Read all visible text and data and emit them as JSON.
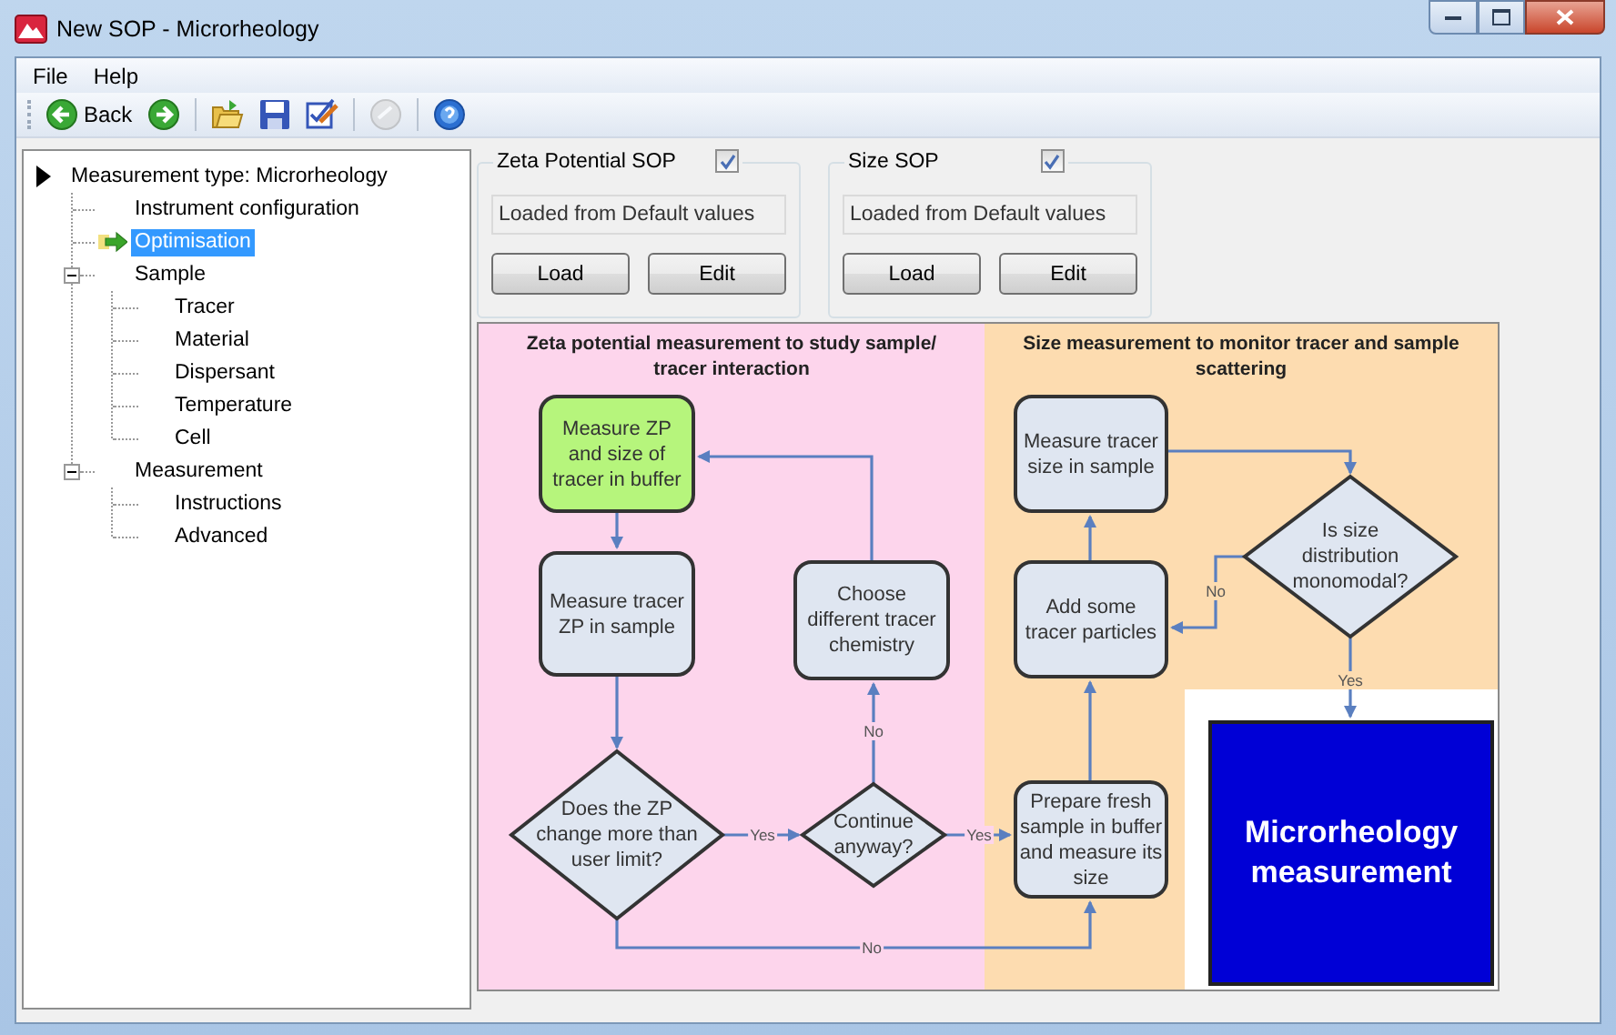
{
  "window": {
    "title": "New SOP - Microrheology"
  },
  "menu": [
    "File",
    "Help"
  ],
  "toolbar": [
    {
      "kind": "back",
      "label": "Back",
      "disabled": false
    },
    {
      "kind": "forward",
      "disabled": false
    },
    {
      "kind": "open",
      "disabled": false
    },
    {
      "kind": "save",
      "disabled": false
    },
    {
      "kind": "edit",
      "disabled": false
    },
    {
      "kind": "cancel",
      "disabled": true
    },
    {
      "kind": "help",
      "disabled": false
    }
  ],
  "tree": {
    "title": "Measurement type: Microrheology",
    "items": [
      {
        "label": "Instrument configuration",
        "selected": false,
        "current": false
      },
      {
        "label": "Optimisation",
        "selected": true,
        "current": true
      },
      {
        "label": "Sample",
        "selected": false,
        "current": false,
        "expanded": true,
        "children": [
          {
            "label": "Tracer",
            "selected": false,
            "current": false
          },
          {
            "label": "Material",
            "selected": false,
            "current": false
          },
          {
            "label": "Dispersant",
            "selected": false,
            "current": false
          },
          {
            "label": "Temperature",
            "selected": false,
            "current": false
          },
          {
            "label": "Cell",
            "selected": false,
            "current": false
          }
        ]
      },
      {
        "label": "Measurement",
        "selected": false,
        "current": false,
        "expanded": true,
        "children": [
          {
            "label": "Instructions",
            "selected": false,
            "current": false
          },
          {
            "label": "Advanced",
            "selected": false,
            "current": false
          }
        ]
      }
    ]
  },
  "sops": [
    {
      "label": "Zeta Potential SOP",
      "checked": true,
      "status": "Loaded from Default values",
      "buttons": [
        "Load",
        "Edit"
      ]
    },
    {
      "label": "Size SOP",
      "checked": true,
      "status": "Loaded from Default values",
      "buttons": [
        "Load",
        "Edit"
      ]
    }
  ],
  "flowchart": {
    "panels": [
      {
        "title": [
          "Zeta potential measurement to study sample/",
          "tracer interaction"
        ],
        "color": "#fdd5ec"
      },
      {
        "title": [
          "Size measurement to monitor tracer and sample",
          "scattering"
        ],
        "color": "#fddcb0"
      }
    ],
    "nodes": [
      {
        "kind": "process",
        "lines": [
          "Measure ZP",
          "and size of",
          "tracer in buffer"
        ],
        "color": "#b6f57c"
      },
      {
        "kind": "process",
        "lines": [
          "Measure tracer",
          "ZP in sample"
        ],
        "color": "#dfe6f1"
      },
      {
        "kind": "process",
        "lines": [
          "Choose",
          "different tracer",
          "chemistry"
        ],
        "color": "#dfe6f1"
      },
      {
        "kind": "decision",
        "lines": [
          "Does the ZP",
          "change more than",
          "user limit?"
        ],
        "color": "#dfe6f1"
      },
      {
        "kind": "decision",
        "lines": [
          "Continue",
          "anyway?"
        ],
        "color": "#dfe6f1"
      },
      {
        "kind": "process",
        "lines": [
          "Measure tracer",
          "size in sample"
        ],
        "color": "#dfe6f1"
      },
      {
        "kind": "decision",
        "lines": [
          "Is size",
          "distribution",
          "monomodal?"
        ],
        "color": "#dfe6f1"
      },
      {
        "kind": "process",
        "lines": [
          "Add some",
          "tracer particles"
        ],
        "color": "#dfe6f1"
      },
      {
        "kind": "process",
        "lines": [
          "Prepare fresh",
          "sample in buffer",
          "and measure its",
          "size"
        ],
        "color": "#dfe6f1"
      },
      {
        "kind": "terminal",
        "lines": [
          "Microrheology",
          "measurement"
        ],
        "color": "#0000d6"
      }
    ],
    "edges": [
      {
        "label": "Yes"
      },
      {
        "label": "Yes"
      },
      {
        "label": "No"
      },
      {
        "label": "No"
      },
      {
        "label": "No"
      },
      {
        "label": "Yes"
      }
    ]
  }
}
